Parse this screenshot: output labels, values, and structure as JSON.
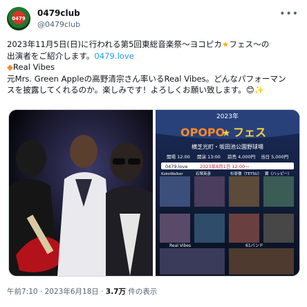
{
  "author": {
    "display_name": "0479club",
    "handle": "@0479club",
    "avatar_icon": "0479club-logo",
    "avatar_text": "0479"
  },
  "menu_icon": "more-horizontal-icon",
  "tweet": {
    "line1": "2023年11月5日(日)に行われる第5回東総音楽祭〜ヨコピカ",
    "line1_star": "★",
    "line1_end": "フェス〜の",
    "line2": "出演者をご紹介します。",
    "link": "0479.love",
    "line3_icon": "◆",
    "line3": "Real Vibes",
    "line4": "元Mrs. Green Appleの高野清宗さん率いるReal Vibes。どんなパフォーマン",
    "line5": "スを披露してくれるのか。楽しみです！よろしくお願い致します。",
    "line5_emoji": "😊✨"
  },
  "flyer": {
    "year": "2023年",
    "title_ascii": "OPOPO",
    "title_star": "★",
    "title_suffix": "フェス",
    "venue": "横芝光町・坂田池公園野球場",
    "open_time": "開場 12:00",
    "start_time": "開演 13:00",
    "adv": "前売 4,000円",
    "door": "当日 5,000円",
    "url": "0479.love",
    "sale": "2023年8月1日 12:00〜",
    "performers": [
      "KokoWalker",
      "石塚英彦",
      "杉原徹（TETSU）",
      "翼（ハッピー）",
      "Real Vibes",
      "61バンド"
    ]
  },
  "meta": {
    "time": "午前7:10",
    "date": "2023年6月18日",
    "views_count": "3.7万",
    "views_label": "件の表示"
  }
}
